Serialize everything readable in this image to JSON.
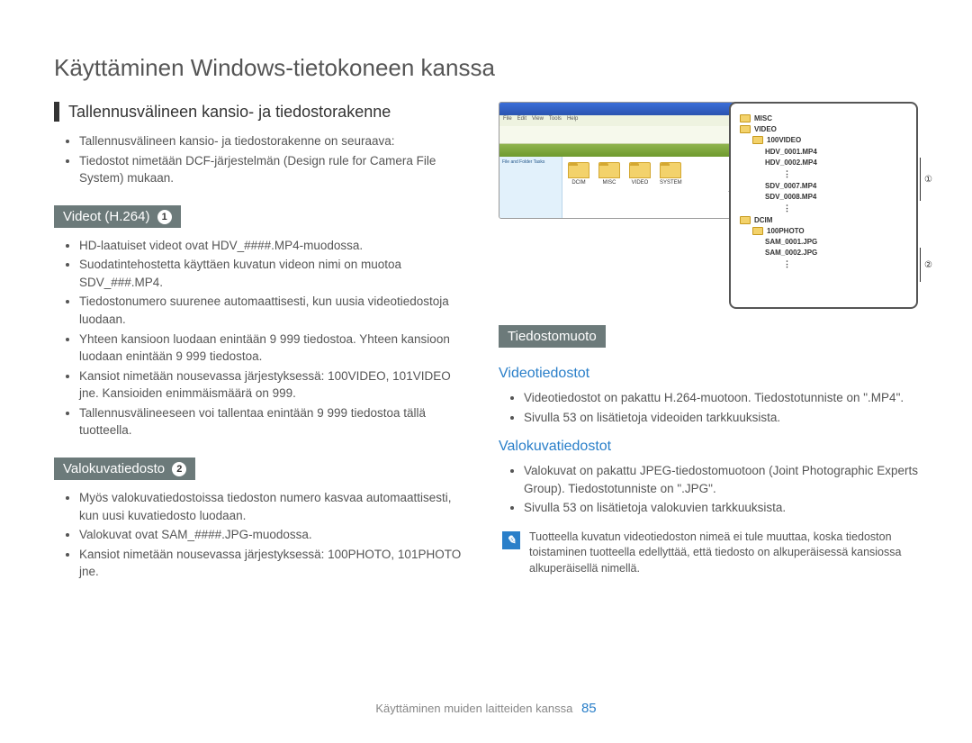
{
  "page_title": "Käyttäminen Windows-tietokoneen kanssa",
  "left": {
    "section_heading": "Tallennusvälineen kansio- ja tiedostorakenne",
    "intro_bullets": [
      "Tallennusvälineen kansio- ja tiedostorakenne on seuraava:",
      "Tiedostot nimetään DCF-järjestelmän (Design rule for Camera File System) mukaan."
    ],
    "videos": {
      "badge": "Videot (H.264)",
      "badge_num": "1",
      "bullets": [
        "HD-laatuiset videot ovat HDV_####.MP4-muodossa.",
        "Suodatintehostetta käyttäen kuvatun videon nimi on muotoa SDV_###.MP4.",
        "Tiedostonumero suurenee automaattisesti, kun uusia videotiedostoja luodaan.",
        "Yhteen kansioon luodaan enintään 9 999 tiedostoa. Yhteen kansioon luodaan enintään 9 999 tiedostoa.",
        "Kansiot nimetään nousevassa järjestyksessä: 100VIDEO, 101VIDEO jne. Kansioiden enimmäismäärä on 999.",
        "Tallennusvälineeseen voi tallentaa enintään 9 999 tiedostoa tällä tuotteella."
      ]
    },
    "photos": {
      "badge": "Valokuvatiedosto",
      "badge_num": "2",
      "bullets": [
        "Myös valokuvatiedostoissa tiedoston numero kasvaa automaattisesti, kun uusi kuvatiedosto luodaan.",
        "Valokuvat ovat SAM_####.JPG-muodossa.",
        "Kansiot nimetään nousevassa järjestyksessä: 100PHOTO, 101PHOTO jne."
      ]
    }
  },
  "right": {
    "explorer": {
      "menu": [
        "File",
        "Edit",
        "View",
        "Tools",
        "Help"
      ],
      "sidebar_label": "File and Folder Tasks",
      "folders": [
        "DCIM",
        "MISC",
        "VIDEO",
        "SYSTEM"
      ]
    },
    "tree": {
      "root1": "MISC",
      "root2": "VIDEO",
      "sub2": "100VIDEO",
      "files2": [
        "HDV_0001.MP4",
        "HDV_0002.MP4",
        "SDV_0007.MP4",
        "SDV_0008.MP4"
      ],
      "root3": "DCIM",
      "sub3": "100PHOTO",
      "files3": [
        "SAM_0001.JPG",
        "SAM_0002.JPG"
      ],
      "marker1": "①",
      "marker2": "②"
    },
    "format": {
      "badge": "Tiedostomuoto",
      "video_heading": "Videotiedostot",
      "video_bullets": [
        "Videotiedostot on pakattu H.264-muotoon. Tiedostotunniste on \".MP4\".",
        "Sivulla 53 on lisätietoja videoiden tarkkuuksista."
      ],
      "photo_heading": "Valokuvatiedostot",
      "photo_bullets": [
        "Valokuvat on pakattu JPEG-tiedostomuotoon (Joint Photographic Experts Group). Tiedostotunniste on \".JPG\".",
        "Sivulla 53 on lisätietoja valokuvien tarkkuuksista."
      ]
    },
    "note": "Tuotteella kuvatun videotiedoston nimeä ei tule muuttaa, koska tiedoston toistaminen tuotteella edellyttää, että tiedosto on alkuperäisessä kansiossa alkuperäisellä nimellä."
  },
  "footer": {
    "text": "Käyttäminen muiden laitteiden kanssa",
    "page_number": "85"
  }
}
